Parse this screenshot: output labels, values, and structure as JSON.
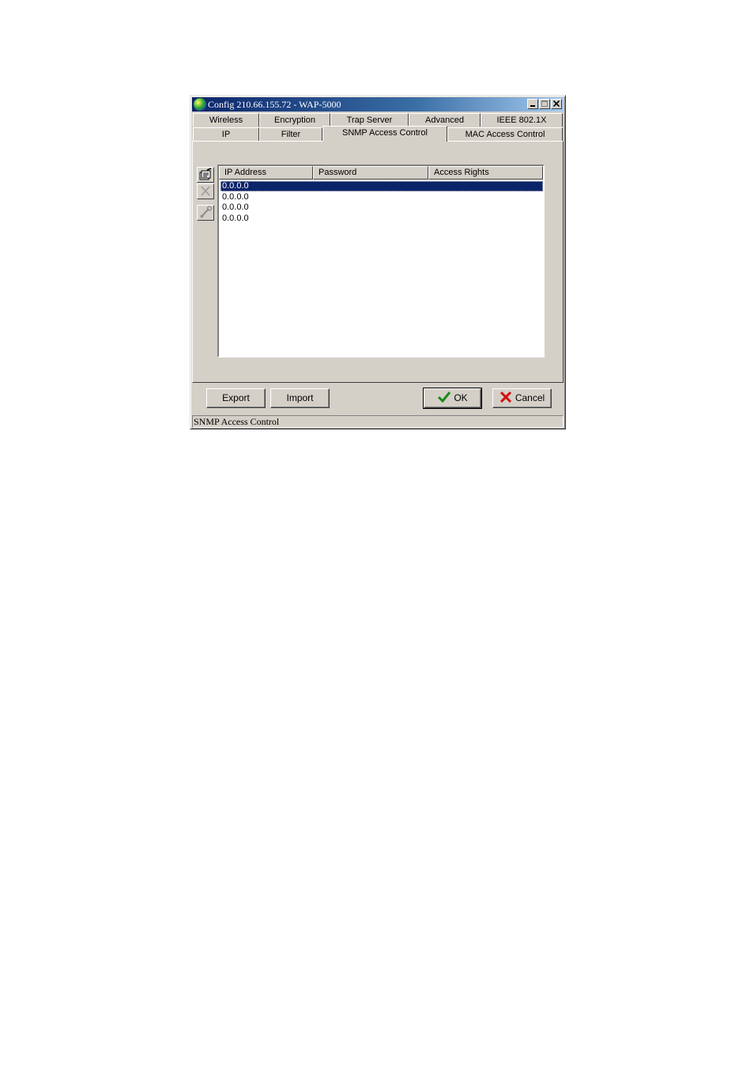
{
  "window": {
    "title": "Config 210.66.155.72 - WAP-5000",
    "minimize": "_",
    "maximize": "□",
    "close": "✕"
  },
  "tabs_row1": [
    "Wireless",
    "Encryption",
    "Trap Server",
    "Advanced",
    "IEEE 802.1X"
  ],
  "tabs_row2": [
    "IP",
    "Filter",
    "SNMP Access Control",
    "MAC Access Control"
  ],
  "active_tab": "SNMP Access Control",
  "table": {
    "columns": [
      "IP Address",
      "Password",
      "Access Rights"
    ],
    "rows": [
      "0.0.0.0",
      "0.0.0.0",
      "0.0.0.0",
      "0.0.0.0"
    ],
    "selected_row": 0
  },
  "side_buttons": [
    "edit-icon",
    "delete-icon",
    "tool-icon"
  ],
  "buttons": {
    "export": "Export",
    "import": "Import",
    "ok": "OK",
    "cancel": "Cancel"
  },
  "status": "SNMP Access Control",
  "colors": {
    "face": "#d4d0c8",
    "title_start": "#0a246a",
    "selection": "#0a246a",
    "ok_check": "#1a8a1a",
    "cancel_x": "#d01010"
  }
}
